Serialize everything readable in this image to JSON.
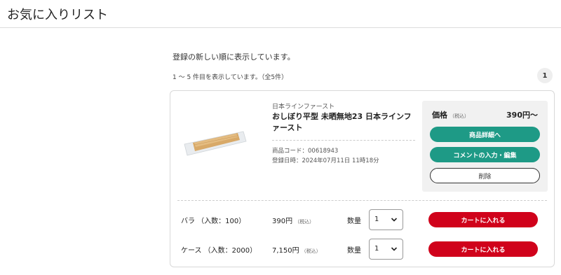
{
  "header": {
    "title": "お気に入りリスト"
  },
  "list": {
    "intro": "登録の新しい順に表示しています。",
    "count_text": "1 ～ 5 件目を表示しています。（全5件）",
    "page_number": "1"
  },
  "item": {
    "manufacturer": "日本ラインファースト",
    "name": "おしぼり平型 未晒無地23 日本ラインファースト",
    "code": "商品コード：00618943",
    "registered": "登録日時：2024年07月11日 11時18分",
    "price_label": "価格",
    "tax_note": "（税込）",
    "price": "390円～",
    "detail_button": "商品詳細へ",
    "comment_button": "コメントの入力・編集",
    "delete_button": "削除"
  },
  "variants": [
    {
      "label": "バラ （入数：100）",
      "price": "390円",
      "tax_note": "（税込）",
      "qty_label": "数量",
      "qty": "1",
      "cart_button": "カートに入れる"
    },
    {
      "label": "ケース （入数：2000）",
      "price": "7,150円",
      "tax_note": "（税込）",
      "qty_label": "数量",
      "qty": "1",
      "cart_button": "カートに入れる"
    }
  ],
  "colors": {
    "accent_teal": "#1e9a86",
    "cart_red": "#d0021b"
  },
  "icons": {
    "select_arrow": "chevron-down-icon"
  }
}
